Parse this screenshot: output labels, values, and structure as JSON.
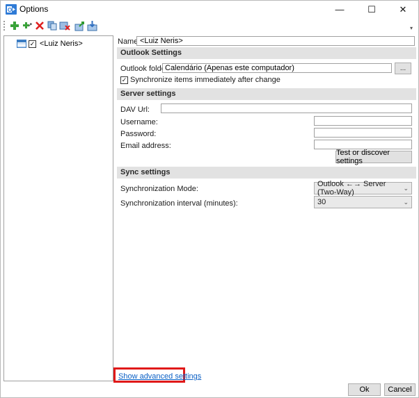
{
  "window": {
    "title": "Options",
    "controls": {
      "minimize": "—",
      "maximize": "☐",
      "close": "✕"
    }
  },
  "toolbar": {
    "buttons": [
      {
        "icon": "add-icon"
      },
      {
        "icon": "add-multiple-icon"
      },
      {
        "icon": "delete-icon"
      },
      {
        "icon": "copy-icon"
      },
      {
        "icon": "clear-icon"
      },
      {
        "icon": "export-icon"
      },
      {
        "icon": "import-icon"
      }
    ]
  },
  "tree": {
    "items": [
      {
        "label": "<Luiz Neris>",
        "checked": true
      }
    ]
  },
  "profile": {
    "name_label": "Name:",
    "name_value": "<Luiz Neris>"
  },
  "outlook": {
    "header": "Outlook Settings",
    "folder_label": "Outlook folder:",
    "folder_value": "Calendário (Apenas este computador)",
    "browse_label": "...",
    "sync_immediately_label": "Synchronize items immediately after change",
    "sync_immediately_checked": true
  },
  "server": {
    "header": "Server settings",
    "dav_url_label": "DAV Url:",
    "dav_url_value": "",
    "username_label": "Username:",
    "username_value": "",
    "password_label": "Password:",
    "password_value": "",
    "email_label": "Email address:",
    "email_value": "",
    "test_button_label": "Test or discover settings"
  },
  "sync": {
    "header": "Sync settings",
    "mode_label": "Synchronization Mode:",
    "mode_value": "Outlook ←→ Server (Two-Way)",
    "interval_label": "Synchronization interval (minutes):",
    "interval_value": "30"
  },
  "footer": {
    "advanced_link": "Show advanced settings",
    "ok_label": "Ok",
    "cancel_label": "Cancel"
  },
  "colors": {
    "link": "#0b5fc4",
    "highlight": "#e01919",
    "section_bg": "#e2e2e2"
  }
}
